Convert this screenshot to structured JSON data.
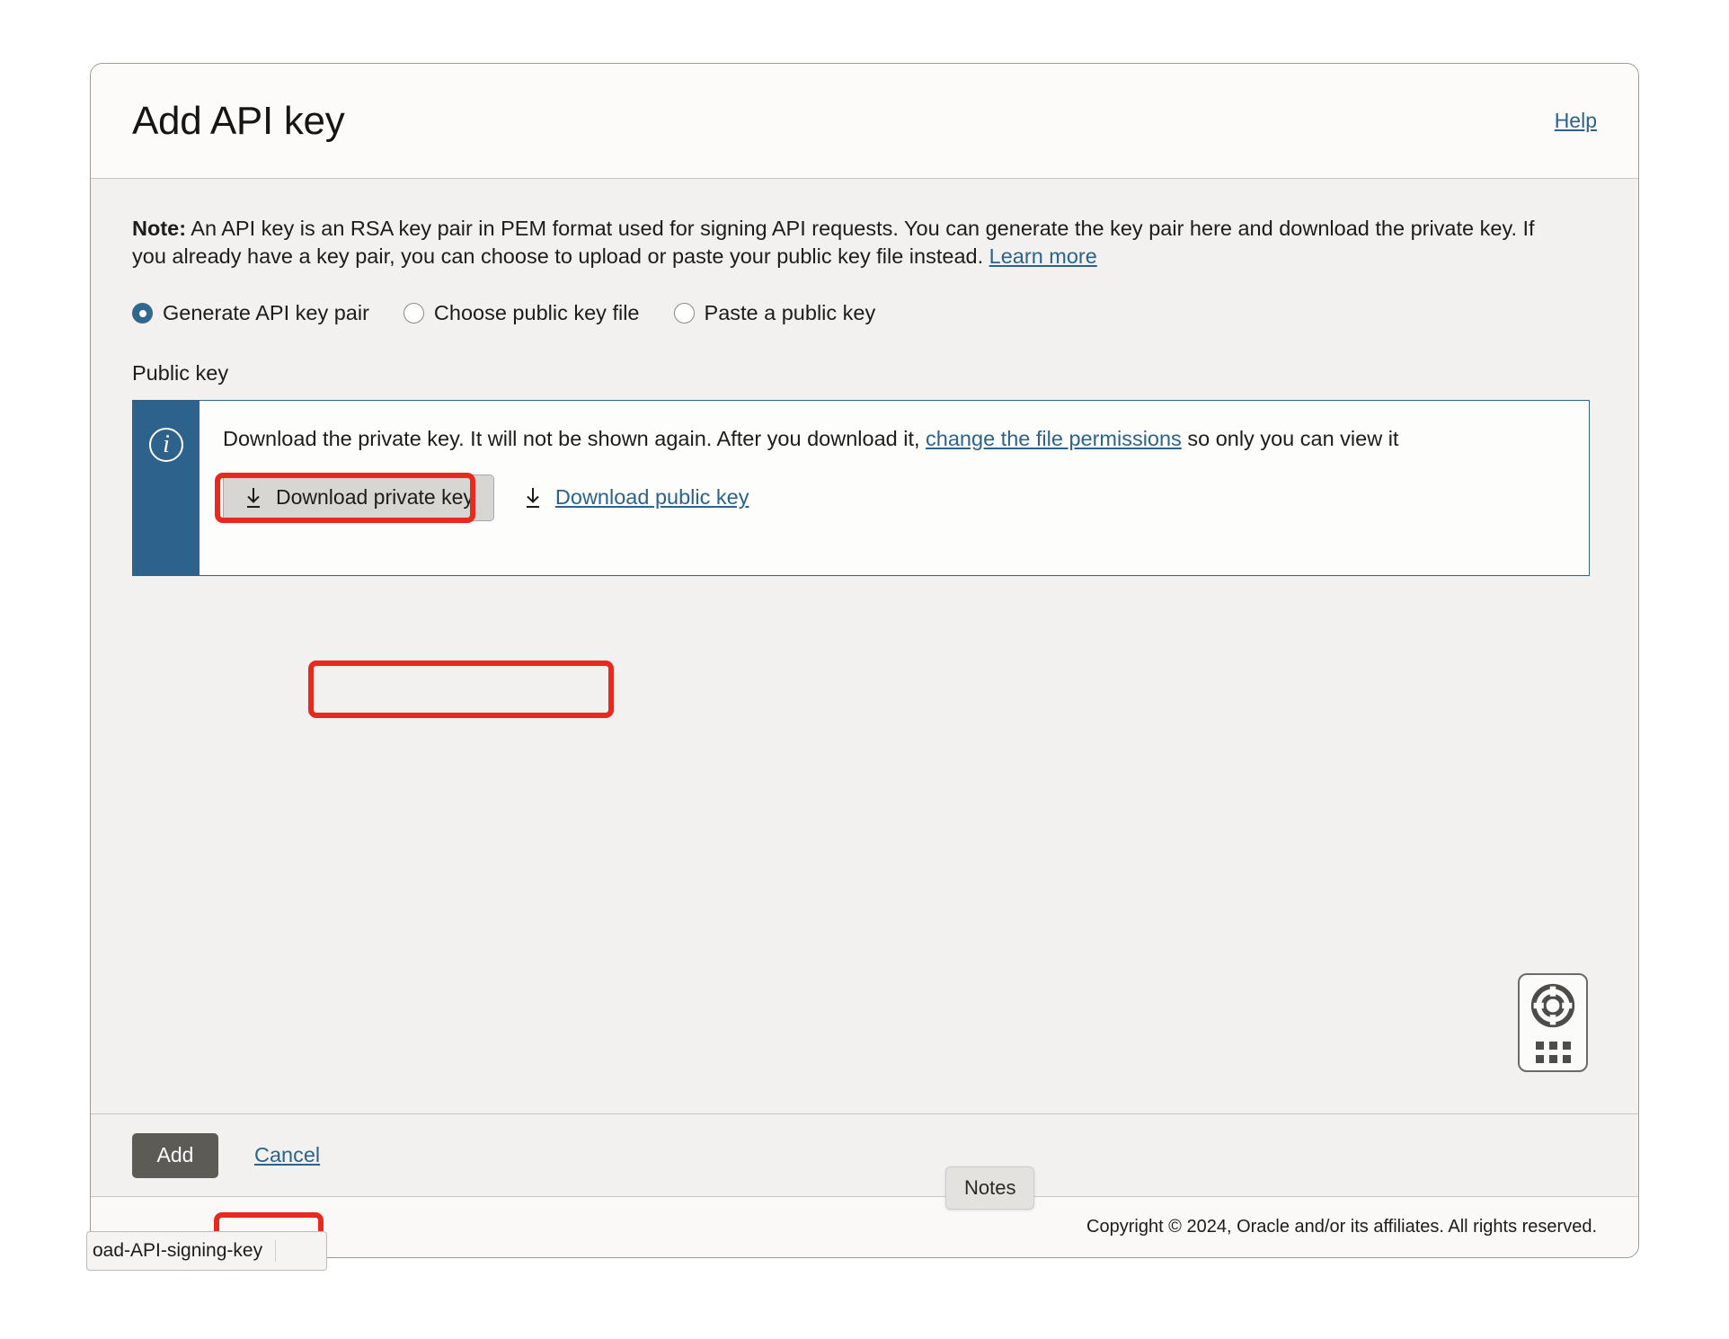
{
  "dialog": {
    "title": "Add API key",
    "help_label": "Help"
  },
  "note": {
    "bold_prefix": "Note:",
    "body": " An API key is an RSA key pair in PEM format used for signing API requests. You can generate the key pair here and download the private key. If you already have a key pair, you can choose to upload or paste your public key file instead. ",
    "learn_more_label": "Learn more"
  },
  "key_source": {
    "options": [
      {
        "label": "Generate API key pair",
        "selected": true
      },
      {
        "label": "Choose public key file",
        "selected": false
      },
      {
        "label": "Paste a public key",
        "selected": false
      }
    ]
  },
  "public_key": {
    "field_label": "Public key",
    "banner": {
      "icon": "info-icon",
      "text_before_link": "Download the private key. It will not be shown again. After you download it, ",
      "link_label": "change the file permissions",
      "text_after_link": " so only you can view it",
      "download_private_label": "Download private key",
      "download_public_label": "Download public key",
      "download_icon": "download-arrow-icon"
    }
  },
  "support": {
    "icon": "lifebuoy-icon",
    "grid_icon": "app-grid-icon"
  },
  "actions": {
    "add_label": "Add",
    "cancel_label": "Cancel"
  },
  "notes_button": {
    "label": "Notes"
  },
  "download_chip": {
    "filename": "oad-API-signing-key"
  },
  "footer": {
    "copyright": "Copyright © 2024, Oracle and/or its affiliates. All rights reserved."
  },
  "colors": {
    "accent_blue": "#2c628c",
    "annotation_red": "#e8291f",
    "primary_button": "#5d5b56",
    "body_background": "#f2f1ef"
  }
}
